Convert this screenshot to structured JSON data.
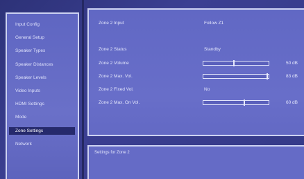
{
  "sidebar": {
    "items": [
      {
        "label": "Input Config"
      },
      {
        "label": "General Setup"
      },
      {
        "label": "Speaker Types"
      },
      {
        "label": "Speaker Distances"
      },
      {
        "label": "Speaker Levels"
      },
      {
        "label": "Video Inputs"
      },
      {
        "label": "HDMI Settings"
      },
      {
        "label": "Mode"
      },
      {
        "label": "Zone Settings",
        "selected": true
      },
      {
        "label": "Network"
      }
    ]
  },
  "main": {
    "zone2_input": {
      "label": "Zone 2 Input",
      "value": "Follow Z1"
    },
    "zone2_status": {
      "label": "Zone 2 Status",
      "value": "Standby"
    },
    "zone2_volume": {
      "label": "Zone 2 Volume",
      "value_text": "50 dB",
      "level": 0.47
    },
    "zone2_max_vol": {
      "label": "Zone 2 Max. Vol.",
      "value_text": "83 dB",
      "level": 0.98
    },
    "zone2_fixed_vol": {
      "label": "Zone 2 Fixed Vol.",
      "value": "No"
    },
    "zone2_max_on_vol": {
      "label": "Zone 2 Max. On Vol.",
      "value_text": "60 dB",
      "level": 0.63
    }
  },
  "description": {
    "text": "Settings for Zone 2"
  }
}
